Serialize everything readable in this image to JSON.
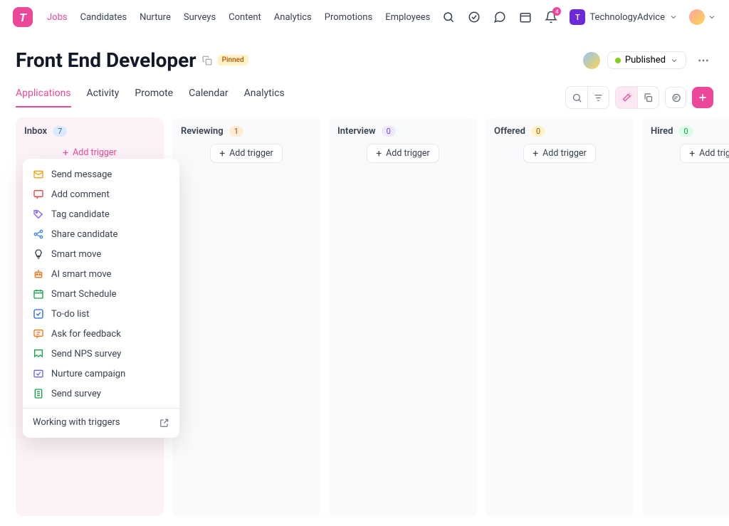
{
  "nav": {
    "links": [
      "Jobs",
      "Candidates",
      "Nurture",
      "Surveys",
      "Content",
      "Analytics",
      "Promotions",
      "Employees"
    ],
    "active_index": 0
  },
  "workspace": {
    "initial": "T",
    "name": "TechnologyAdvice"
  },
  "bell_count": "4",
  "page": {
    "title": "Front End Developer",
    "pinned_label": "Pinned",
    "status": "Published"
  },
  "tabs": {
    "items": [
      "Applications",
      "Activity",
      "Promote",
      "Calendar",
      "Analytics"
    ],
    "active_index": 0
  },
  "columns": [
    {
      "title": "Inbox",
      "count": "7",
      "count_class": "count-blue",
      "trigger_label": "Add trigger",
      "active": true
    },
    {
      "title": "Reviewing",
      "count": "1",
      "count_class": "count-orange",
      "trigger_label": "Add trigger",
      "active": false
    },
    {
      "title": "Interview",
      "count": "0",
      "count_class": "count-purple",
      "trigger_label": "Add trigger",
      "active": false
    },
    {
      "title": "Offered",
      "count": "0",
      "count_class": "count-yellow",
      "trigger_label": "Add trigger",
      "active": false
    },
    {
      "title": "Hired",
      "count": "0",
      "count_class": "count-green",
      "trigger_label": "Add trigger",
      "active": false
    }
  ],
  "trigger_menu": {
    "items": [
      {
        "label": "Send message",
        "icon": "envelope",
        "color": "#f59e0b"
      },
      {
        "label": "Add comment",
        "icon": "comment",
        "color": "#ef4444"
      },
      {
        "label": "Tag candidate",
        "icon": "tag",
        "color": "#8b5cf6"
      },
      {
        "label": "Share candidate",
        "icon": "share",
        "color": "#3b82f6"
      },
      {
        "label": "Smart move",
        "icon": "bulb",
        "color": "#374151"
      },
      {
        "label": "AI smart move",
        "icon": "robot",
        "color": "#f97316"
      },
      {
        "label": "Smart Schedule",
        "icon": "calendar",
        "color": "#16a34a"
      },
      {
        "label": "To-do list",
        "icon": "check",
        "color": "#2563eb"
      },
      {
        "label": "Ask for feedback",
        "icon": "feedback",
        "color": "#f97316"
      },
      {
        "label": "Send NPS survey",
        "icon": "survey",
        "color": "#16a34a"
      },
      {
        "label": "Nurture campaign",
        "icon": "nurture",
        "color": "#6366f1"
      },
      {
        "label": "Send survey",
        "icon": "form",
        "color": "#16a34a"
      }
    ],
    "footer": "Working with triggers"
  },
  "colors": {
    "accent": "#ec4899"
  }
}
